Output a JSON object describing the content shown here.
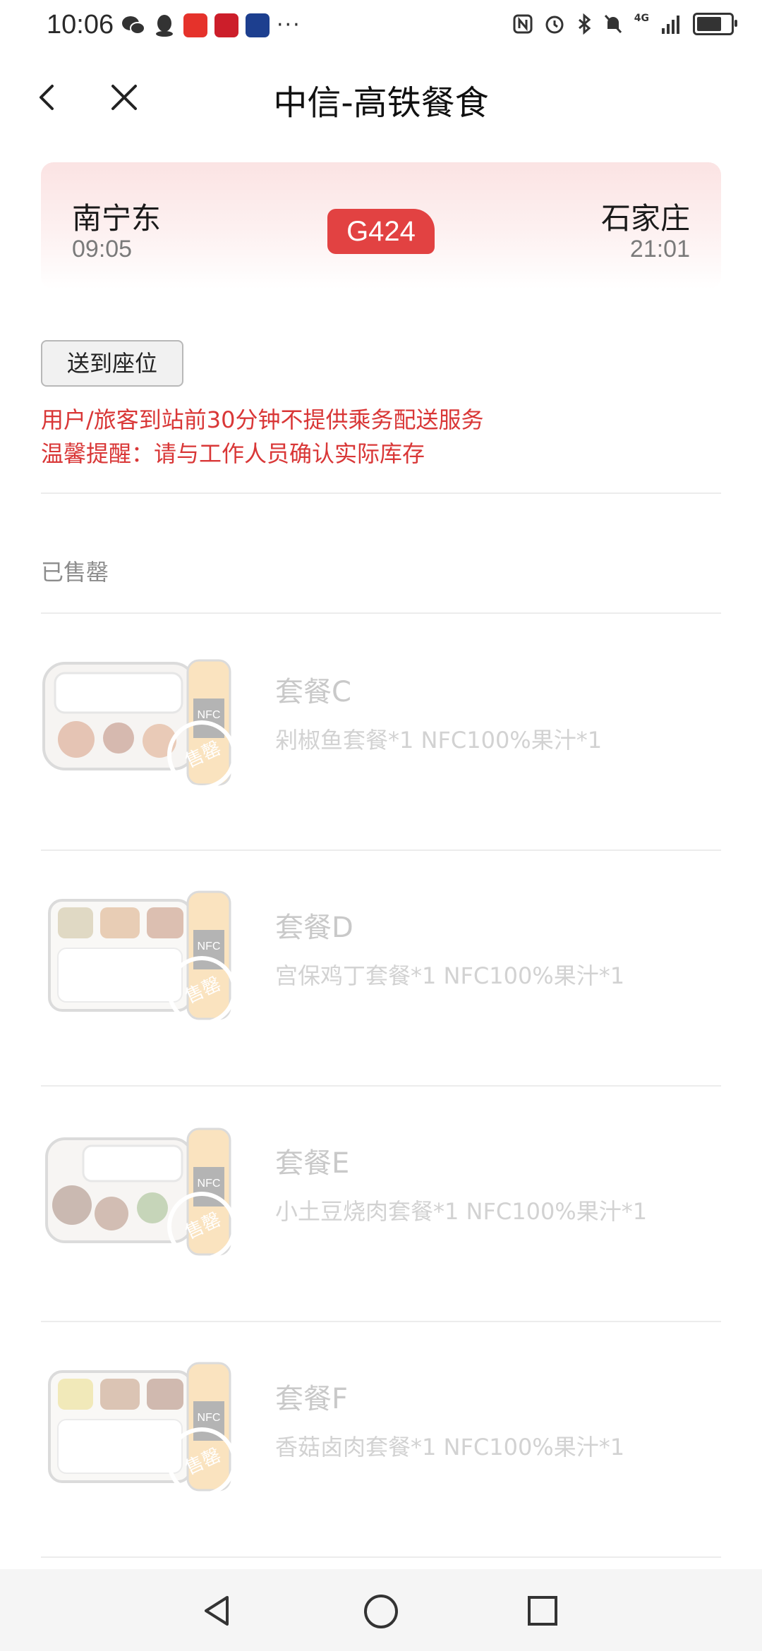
{
  "status_bar": {
    "time": "10:06",
    "left_icons": [
      "wechat-icon",
      "qq-icon",
      "app-icon",
      "app-icon",
      "app-icon"
    ],
    "more": "···",
    "right_icons": [
      "nfc-icon",
      "alarm-icon",
      "bluetooth-icon",
      "mute-icon",
      "signal-4g-icon",
      "battery-icon"
    ],
    "network": "4G",
    "battery_level": 0.85
  },
  "nav": {
    "title": "中信-高铁餐食"
  },
  "train": {
    "from_station": "南宁东",
    "from_time": "09:05",
    "to_station": "石家庄",
    "to_time": "21:01",
    "number": "G424"
  },
  "deliver_button": "送到座位",
  "notices": [
    "用户/旅客到站前30分钟不提供乘务配送服务",
    "温馨提醒：请与工作人员确认实际库存"
  ],
  "section_label": "已售罄",
  "products": [
    {
      "name": "套餐C",
      "desc": "剁椒鱼套餐*1 NFC100%果汁*1"
    },
    {
      "name": "套餐D",
      "desc": "宫保鸡丁套餐*1 NFC100%果汁*1"
    },
    {
      "name": "套餐E",
      "desc": "小土豆烧肉套餐*1 NFC100%果汁*1"
    },
    {
      "name": "套餐F",
      "desc": "香菇卤肉套餐*1 NFC100%果汁*1"
    }
  ],
  "product_image_labels": {
    "bottle": "NFC",
    "stamp": "售罄"
  },
  "colors": {
    "accent": "#e24242",
    "notice": "#d93737",
    "card_bg": "#fbe3e3"
  }
}
